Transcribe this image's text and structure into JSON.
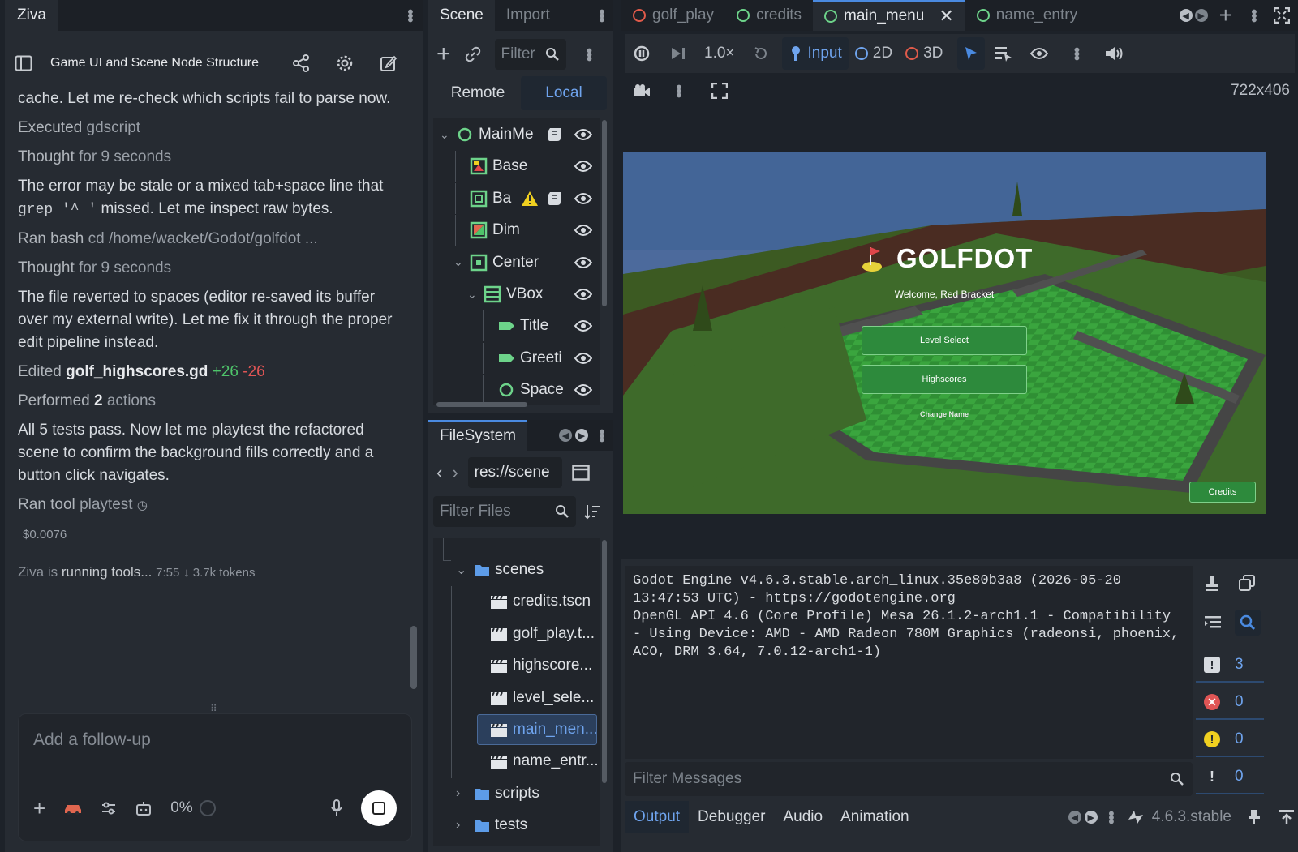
{
  "ziva": {
    "tab": "Ziva",
    "conversation_title": "Game UI and Scene Node Structure",
    "messages": [
      {
        "kind": "text",
        "text": "cache. Let me re-check which scripts fail to parse now."
      },
      {
        "kind": "meta",
        "label": "Executed",
        "detail": "gdscript"
      },
      {
        "kind": "meta",
        "label": "Thought",
        "detail": "for 9 seconds"
      },
      {
        "kind": "code",
        "pre": "The error may be stale or a mixed tab+space line that ",
        "code": "grep '^ '",
        "post": " missed. Let me inspect raw bytes."
      },
      {
        "kind": "meta",
        "label": "Ran bash",
        "detail": "cd /home/wacket/Godot/golfdot ..."
      },
      {
        "kind": "meta",
        "label": "Thought",
        "detail": "for 9 seconds"
      },
      {
        "kind": "text",
        "text": "The file reverted to spaces (editor re-saved its buffer over my external write). Let me fix it through the proper edit pipeline instead."
      },
      {
        "kind": "edit",
        "label": "Edited",
        "file": "golf_highscores.gd",
        "added": "+26",
        "removed": "-26"
      },
      {
        "kind": "actions",
        "label": "Performed",
        "count": "2",
        "suffix": "actions"
      },
      {
        "kind": "text",
        "text": "All 5 tests pass. Now let me playtest the refactored scene to confirm the background fills correctly and a button click navigates."
      },
      {
        "kind": "tool",
        "label": "Ran tool",
        "detail": "playtest"
      },
      {
        "kind": "cost",
        "text": "$0.0076"
      }
    ],
    "status": {
      "name": "Ziva",
      "is": "is",
      "running": "running tools...",
      "time": "7:55",
      "tokens": "↓ 3.7k tokens"
    },
    "input_placeholder": "Add a follow-up",
    "context_percent": "0%"
  },
  "scene": {
    "tabs": [
      "Scene",
      "Import"
    ],
    "filter_placeholder": "Filter",
    "remote": "Remote",
    "local": "Local",
    "nodes": [
      {
        "name": "MainMe",
        "depth": 0,
        "icon": "control-node-icon",
        "color": "#6dd38a",
        "expand": true,
        "script": true,
        "warning": false
      },
      {
        "name": "Base",
        "depth": 1,
        "icon": "texture-rect-icon",
        "color": "#6dd38a",
        "expand": false,
        "script": false,
        "warning": false
      },
      {
        "name": "Ba",
        "depth": 1,
        "icon": "panel-icon",
        "color": "#6dd38a",
        "expand": false,
        "script": true,
        "warning": true
      },
      {
        "name": "Dim",
        "depth": 1,
        "icon": "color-rect-icon",
        "color": "#6dd38a",
        "expand": false,
        "script": false,
        "warning": false
      },
      {
        "name": "Center",
        "depth": 1,
        "icon": "center-container-icon",
        "color": "#6dd38a",
        "expand": true,
        "script": false,
        "warning": false
      },
      {
        "name": "VBox",
        "depth": 2,
        "icon": "vbox-icon",
        "color": "#6dd38a",
        "expand": true,
        "script": false,
        "warning": false
      },
      {
        "name": "Title",
        "depth": 3,
        "icon": "label-icon",
        "color": "#6dd38a",
        "expand": false,
        "script": false,
        "warning": false
      },
      {
        "name": "Greeti",
        "depth": 3,
        "icon": "label-icon",
        "color": "#6dd38a",
        "expand": false,
        "script": false,
        "warning": false
      },
      {
        "name": "Space",
        "depth": 3,
        "icon": "control-node-icon",
        "color": "#6dd38a",
        "expand": false,
        "script": false,
        "warning": false
      }
    ]
  },
  "filesystem": {
    "tab": "FileSystem",
    "path": "res://scene",
    "filter_placeholder": "Filter Files",
    "items": [
      {
        "name": "scenes",
        "type": "folder",
        "depth": 0,
        "expanded": true,
        "selected": false
      },
      {
        "name": "credits.tscn",
        "type": "scene",
        "depth": 1,
        "selected": false
      },
      {
        "name": "golf_play.t...",
        "type": "scene",
        "depth": 1,
        "selected": false
      },
      {
        "name": "highscore...",
        "type": "scene",
        "depth": 1,
        "selected": false
      },
      {
        "name": "level_sele...",
        "type": "scene",
        "depth": 1,
        "selected": false
      },
      {
        "name": "main_men...",
        "type": "scene",
        "depth": 1,
        "selected": true
      },
      {
        "name": "name_entr...",
        "type": "scene",
        "depth": 1,
        "selected": false
      },
      {
        "name": "scripts",
        "type": "folder",
        "depth": 0,
        "expanded": false,
        "selected": false
      },
      {
        "name": "tests",
        "type": "folder",
        "depth": 0,
        "expanded": false,
        "selected": false
      }
    ]
  },
  "editor_tabs": [
    {
      "name": "golf_play",
      "dot": "#e05a4a",
      "active": false
    },
    {
      "name": "credits",
      "dot": "#6dd38a",
      "active": false
    },
    {
      "name": "main_menu",
      "dot": "#6dd38a",
      "active": true
    },
    {
      "name": "name_entry",
      "dot": "#6dd38a",
      "active": false
    }
  ],
  "toolbar": {
    "speed": "1.0×",
    "input": "Input",
    "mode_2d": "2D",
    "mode_3d": "3D",
    "resolution": "722x406"
  },
  "game": {
    "title": "GOLFDOT",
    "greeting": "Welcome, Red Bracket",
    "buttons": [
      "Level Select",
      "Highscores"
    ],
    "change_name": "Change Name",
    "credits": "Credits"
  },
  "output": {
    "log": "Godot Engine v4.6.3.stable.arch_linux.35e80b3a8 (2026-05-20 13:47:53 UTC) - https://godotengine.org\nOpenGL API 4.6 (Core Profile) Mesa 26.1.2-arch1.1 - Compatibility - Using Device: AMD - AMD Radeon 780M Graphics (radeonsi, phoenix, ACO, DRM 3.64, 7.0.12-arch1-1)",
    "filter_placeholder": "Filter Messages",
    "counts": {
      "messages": "3",
      "errors": "0",
      "warnings": "0",
      "verbose": "0"
    }
  },
  "bottom_tabs": [
    "Output",
    "Debugger",
    "Audio",
    "Animation"
  ],
  "version": "4.6.3.stable",
  "colors": {
    "accent": "#4a8ae0",
    "node_green": "#6dd38a",
    "panel": "#262b32",
    "bg": "#1d2229"
  }
}
